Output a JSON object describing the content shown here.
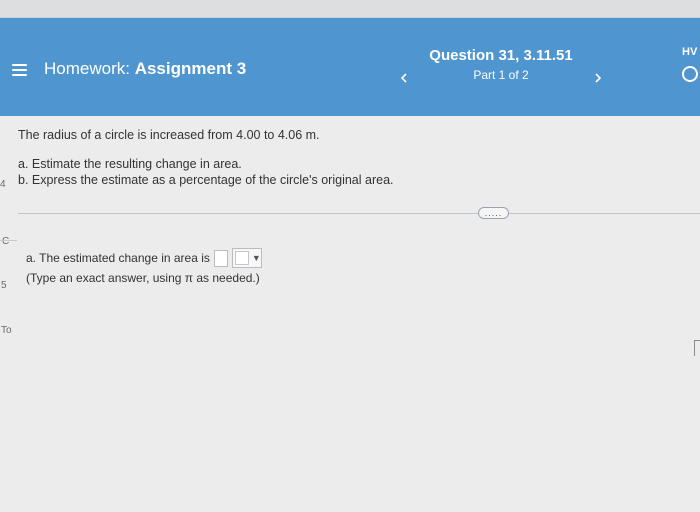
{
  "header": {
    "title_prefix": "Homework:",
    "title_name": "Assignment 3",
    "question_title": "Question 31, 3.11.51",
    "question_part": "Part 1 of 2",
    "score_label": "HV",
    "icons": {
      "menu": "hamburger-menu-icon",
      "prev": "chevron-left-icon",
      "next": "chevron-right-icon",
      "score": "circle-ring-icon"
    },
    "colors": {
      "header_bg": "#4f95cf",
      "content_bg": "#ececed"
    }
  },
  "left_edge": {
    "mark1": "4",
    "mark2": "C",
    "mark3": "5",
    "mark4": "To"
  },
  "problem": {
    "statement": "The radius of a circle is increased from 4.00 to 4.06 m.",
    "part_a": "a. Estimate the resulting change in area.",
    "part_b": "b. Express the estimate as a percentage of the circle's original area."
  },
  "expand_button": {
    "label": "....."
  },
  "answer": {
    "label": "a. The estimated change in area is",
    "input_value": "",
    "unit_value": "",
    "dropdown_arrow": "▼",
    "hint": "(Type an exact answer, using π as needed.)"
  }
}
